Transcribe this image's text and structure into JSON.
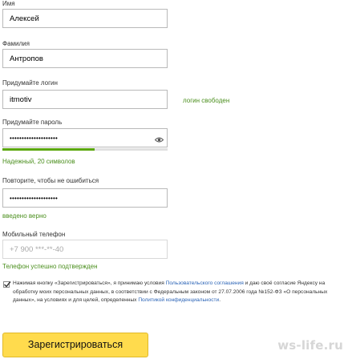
{
  "form": {
    "first_name": {
      "label": "Имя",
      "value": "Алексей"
    },
    "last_name": {
      "label": "Фамилия",
      "value": "Антропов"
    },
    "login": {
      "label": "Придумайте логин",
      "value": "itmotiv",
      "status": "логин свободен"
    },
    "password": {
      "label": "Придумайте пароль",
      "value": "••••••••••••••••••••",
      "strength_text": "Надежный, 20 символов",
      "strength_fraction": 0.56
    },
    "password_repeat": {
      "label": "Повторите, чтобы не ошибиться",
      "value": "••••••••••••••••••••",
      "status": "введено верно"
    },
    "phone": {
      "label": "Мобильный телефон",
      "placeholder": "+7 900 ***-**-40",
      "status": "Телефон успешно подтвержден"
    },
    "terms": {
      "text_1": "Нажимая кнопку «Зарегистрироваться», я принимаю условия ",
      "link_1": "Пользовательского соглашения",
      "text_2": " и даю своё согласие Яндексу на обработку моих персональных данных, в соответствии с Федеральным законом от 27.07.2006 года №152-ФЗ «О персональных данных», на условиях и для целей, определенных ",
      "link_2": "Политикой конфиденциальности",
      "text_3": "."
    },
    "submit_label": "Зарегистрироваться"
  },
  "watermark": "ws-life.ru",
  "colors": {
    "button": "#ffdb4d",
    "success": "#4b8f1e",
    "link": "#2a63b6",
    "strength_bar": "#5aa70a"
  },
  "icons": {
    "password_toggle": "eye-icon",
    "consent": "checkbox-checked"
  }
}
